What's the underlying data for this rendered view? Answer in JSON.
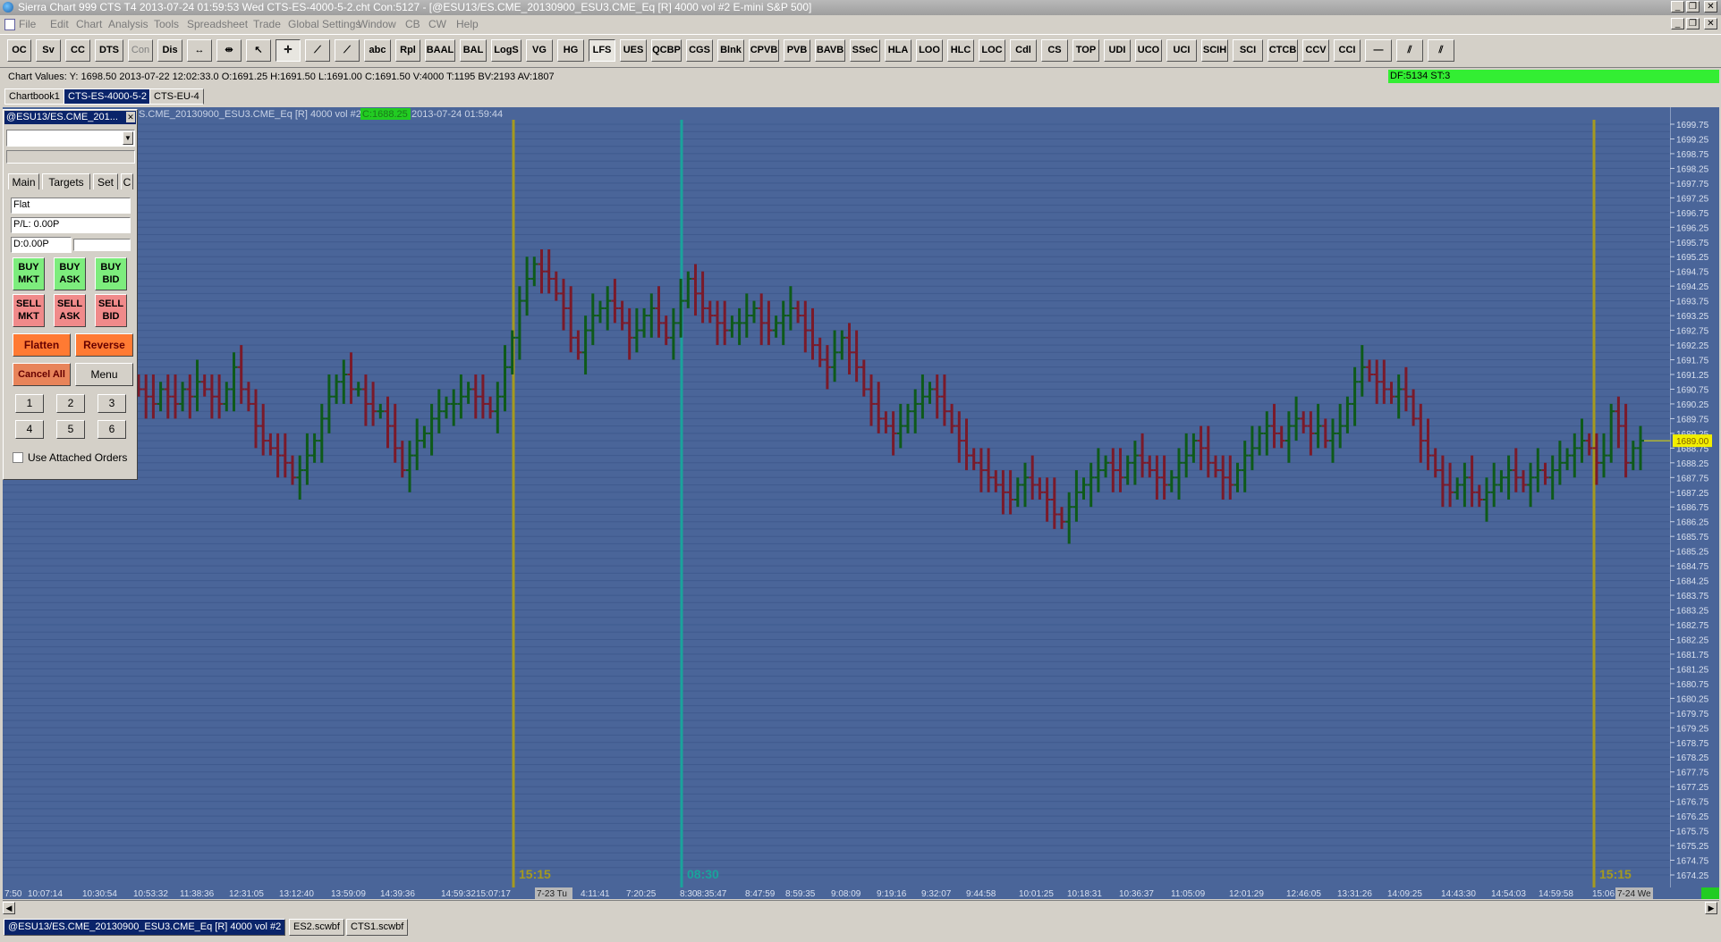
{
  "window": {
    "title": "Sierra Chart 999 CTS T4 2013-07-24  01:59:53 Wed  CTS-ES-4000-5-2.cht Con:5127 - [@ESU13/ES.CME_20130900_ESU3.CME_Eq [R]  4000 vol  #2  E-mini S&P 500]",
    "minimize": "_",
    "restore": "❐",
    "close": "✕"
  },
  "menu": [
    "File",
    "Edit",
    "Chart",
    "Analysis",
    "Tools",
    "Spreadsheet",
    "Trade",
    "Global Settings",
    "Window",
    "CB",
    "CW",
    "Help"
  ],
  "toolbar": [
    "OC",
    "Sv",
    "CC",
    "DTS",
    "Con",
    "Dis",
    "↔",
    "⇹",
    "↖",
    "✛",
    "⟋",
    "⟋",
    "abc",
    "Rpl",
    "BAAL",
    "BAL",
    "LogS",
    "VG",
    "HG",
    "LFS",
    "UES",
    "QCBP",
    "CGS",
    "Blnk",
    "CPVB",
    "PVB",
    "BAVB",
    "SSeC",
    "HLA",
    "LOO",
    "HLC",
    "LOC",
    "Cdl",
    "CS",
    "TOP",
    "UDI",
    "UCO",
    "UCI",
    "SCIH",
    "SCI",
    "CTCB",
    "CCV",
    "CCI",
    "—",
    "⫽",
    "⫽"
  ],
  "chart_values": "Chart Values: Y: 1698.50  2013-07-22  12:02:33.0  O:1691.25  H:1691.50  L:1691.00  C:1691.50  V:4000  T:1195  BV:2193  AV:1807",
  "df_status": "DF:5134  ST:3",
  "tabs": [
    "Chartbook1",
    "CTS-ES-4000-5-2",
    "CTS-EU-4"
  ],
  "chart_header": {
    "symbol": "S.CME_20130900_ESU3.CME_Eq [R]  4000 vol  #2",
    "tag": "C:1688.25",
    "timestamp": "2013-07-24 01:59:44"
  },
  "session_labels": [
    "15:15",
    "08:30",
    "15:15"
  ],
  "current_price": "1689.00",
  "price_scale": [
    "1699.75",
    "1699.25",
    "1698.75",
    "1698.25",
    "1697.75",
    "1697.25",
    "1696.75",
    "1696.25",
    "1695.75",
    "1695.25",
    "1694.75",
    "1694.25",
    "1693.75",
    "1693.25",
    "1692.75",
    "1692.25",
    "1691.75",
    "1691.25",
    "1690.75",
    "1690.25",
    "1689.75",
    "1689.25",
    "1688.75",
    "1688.25",
    "1687.75",
    "1687.25",
    "1686.75",
    "1686.25",
    "1685.75",
    "1685.25",
    "1684.75",
    "1684.25",
    "1683.75",
    "1683.25",
    "1682.75",
    "1682.25",
    "1681.75",
    "1681.25",
    "1680.75",
    "1680.25",
    "1679.75",
    "1679.25",
    "1678.75",
    "1678.25",
    "1677.75",
    "1677.25",
    "1676.75",
    "1676.25",
    "1675.75",
    "1675.25",
    "1674.75",
    "1674.25"
  ],
  "time_scale": [
    "7:50",
    "10:07:14",
    "10:30:54",
    "10:53:32",
    "11:38:36",
    "12:31:05",
    "13:12:40",
    "13:59:09",
    "14:39:36",
    "14:59:32",
    "15:07:17",
    "7-23 Tu",
    "4:11:41",
    "7:20:25",
    "8:30",
    "8:35:47",
    "8:47:59",
    "8:59:35",
    "9:08:09",
    "9:19:16",
    "9:32:07",
    "9:44:58",
    "10:01:25",
    "10:18:31",
    "10:36:37",
    "11:05:09",
    "12:01:29",
    "12:46:05",
    "13:31:26",
    "14:09:25",
    "14:43:30",
    "14:54:03",
    "14:59:58",
    "15:06:28",
    "7-24 We"
  ],
  "trade_panel": {
    "title": "@ESU13/ES.CME_201...",
    "close": "✕",
    "tabs": [
      "Main",
      "Targets",
      "Set",
      "C"
    ],
    "position": "Flat",
    "pl": "P/L: 0.00P",
    "daily": "D:0.00P",
    "buy": [
      [
        "BUY",
        "MKT"
      ],
      [
        "BUY",
        "ASK"
      ],
      [
        "BUY",
        "BID"
      ]
    ],
    "sell": [
      [
        "SELL",
        "MKT"
      ],
      [
        "SELL",
        "ASK"
      ],
      [
        "SELL",
        "BID"
      ]
    ],
    "flatten": "Flatten",
    "reverse": "Reverse",
    "cancel_all": "Cancel All",
    "menu": "Menu",
    "numbers": [
      "1",
      "2",
      "3",
      "4",
      "5",
      "6"
    ],
    "attached_orders": "Use Attached Orders"
  },
  "status_tabs": [
    "@ESU13/ES.CME_20130900_ESU3.CME_Eq [R]  4000 vol  #2",
    "ES2.scwbf",
    "CTS1.scwbf"
  ],
  "chart_data": {
    "type": "bar",
    "style": "OHLC bars, green up / maroon down",
    "ylim": [
      1674.25,
      1699.75
    ],
    "closes": [
      1690.75,
      1690.5,
      1690.25,
      1690.75,
      1690.5,
      1690.25,
      1690.75,
      1690.5,
      1691,
      1690.75,
      1690.5,
      1690.25,
      1690.75,
      1691.5,
      1690.75,
      1690.25,
      1689.5,
      1689,
      1688.75,
      1688.5,
      1688.25,
      1687.75,
      1688,
      1688.5,
      1689,
      1689.75,
      1690.5,
      1691,
      1691.25,
      1690.75,
      1690.75,
      1690.25,
      1690,
      1690,
      1689.5,
      1688.75,
      1688,
      1688.5,
      1689,
      1689.25,
      1689.75,
      1690,
      1690.25,
      1690.25,
      1690.5,
      1690.75,
      1690.5,
      1690.25,
      1690,
      1690.5,
      1691.5,
      1692.5,
      1693.75,
      1694.5,
      1695,
      1694.75,
      1694.5,
      1694,
      1693.5,
      1692.5,
      1692,
      1692.75,
      1693.25,
      1693.5,
      1693.75,
      1693.5,
      1693,
      1692.5,
      1692.75,
      1693.25,
      1693.5,
      1693,
      1692.5,
      1693,
      1693.75,
      1694.5,
      1694,
      1693.5,
      1693.25,
      1693,
      1692.75,
      1693,
      1693,
      1693.25,
      1693.5,
      1693,
      1692.75,
      1693,
      1693.25,
      1693.5,
      1693.25,
      1692.75,
      1692.25,
      1691.75,
      1691.5,
      1692,
      1692.5,
      1692,
      1691.5,
      1690.75,
      1690.25,
      1689.75,
      1689.5,
      1689.25,
      1689.5,
      1690,
      1690.25,
      1690.5,
      1690.75,
      1690.5,
      1690,
      1689.5,
      1689,
      1688.5,
      1688.25,
      1688,
      1687.75,
      1687.5,
      1687.25,
      1687,
      1687.5,
      1687.75,
      1687.5,
      1687.25,
      1687,
      1686.5,
      1686.25,
      1686.75,
      1687.25,
      1687.5,
      1687.75,
      1688,
      1688.25,
      1688,
      1687.75,
      1688.25,
      1688.5,
      1688.25,
      1688,
      1687.75,
      1687.5,
      1687.75,
      1688.25,
      1688.5,
      1689,
      1688.75,
      1688.25,
      1688,
      1687.75,
      1687.5,
      1688,
      1688.5,
      1688.75,
      1689.25,
      1689.5,
      1689.25,
      1689,
      1689.5,
      1689.75,
      1689.5,
      1689.25,
      1689.5,
      1689,
      1689.25,
      1689.5,
      1690.25,
      1691,
      1691.5,
      1691.25,
      1691,
      1690.75,
      1690.5,
      1690.75,
      1690.5,
      1689.75,
      1689,
      1688.5,
      1688,
      1687.5,
      1687.25,
      1687.5,
      1687.75,
      1687.25,
      1687,
      1687.25,
      1687.5,
      1687.75,
      1688,
      1687.75,
      1687.5,
      1687.75,
      1688,
      1687.75,
      1688,
      1688.25,
      1688.5,
      1688.75,
      1689,
      1688.75,
      1688.25,
      1688.5,
      1690,
      1689.5,
      1688.25,
      1688.75,
      1689
    ]
  }
}
